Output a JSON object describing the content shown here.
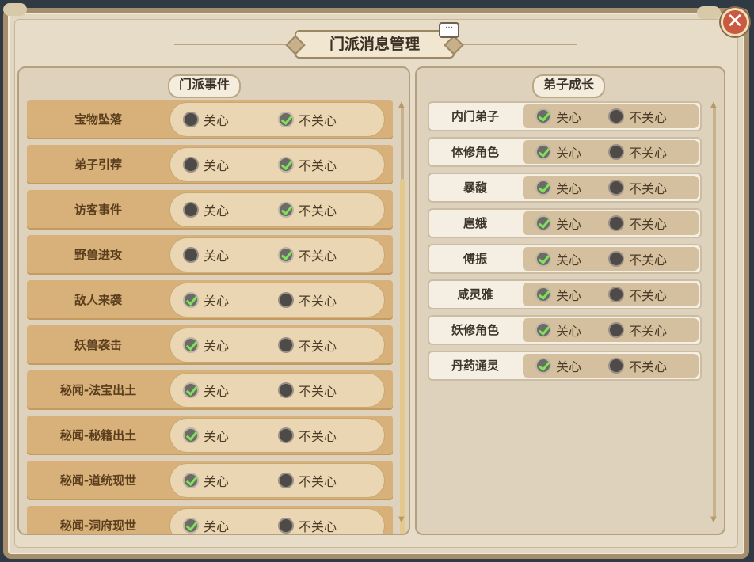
{
  "title": "门派消息管理",
  "close_label": "✕",
  "chat_label": "···",
  "options": {
    "care": "关心",
    "nocare": "不关心"
  },
  "left_panel": {
    "title": "门派事件",
    "rows": [
      {
        "label": "宝物坠落",
        "care": false
      },
      {
        "label": "弟子引荐",
        "care": false
      },
      {
        "label": "访客事件",
        "care": false
      },
      {
        "label": "野兽进攻",
        "care": false
      },
      {
        "label": "敌人来袭",
        "care": true
      },
      {
        "label": "妖兽袭击",
        "care": true
      },
      {
        "label": "秘闻-法宝出土",
        "care": true
      },
      {
        "label": "秘闻-秘籍出土",
        "care": true
      },
      {
        "label": "秘闻-道统现世",
        "care": true
      },
      {
        "label": "秘闻-洞府现世",
        "care": true
      }
    ]
  },
  "right_panel": {
    "title": "弟子成长",
    "rows": [
      {
        "label": "内门弟子",
        "care": true
      },
      {
        "label": "体修角色",
        "care": true
      },
      {
        "label": "暴馥",
        "care": true
      },
      {
        "label": "扈娥",
        "care": true
      },
      {
        "label": "傅振",
        "care": true
      },
      {
        "label": "咸灵雅",
        "care": true
      },
      {
        "label": "妖修角色",
        "care": true
      },
      {
        "label": "丹药通灵",
        "care": true
      }
    ]
  }
}
